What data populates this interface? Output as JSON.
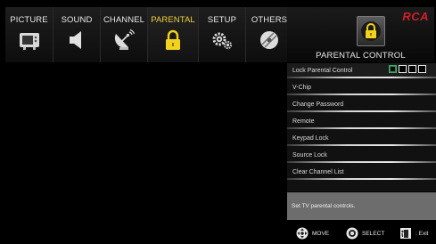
{
  "tabs": [
    {
      "label": "PICTURE",
      "icon": "tv-icon",
      "active": false
    },
    {
      "label": "SOUND",
      "icon": "speaker-icon",
      "active": false
    },
    {
      "label": "CHANNEL",
      "icon": "satellite-dish-icon",
      "active": false
    },
    {
      "label": "PARENTAL",
      "icon": "lock-icon",
      "active": true
    },
    {
      "label": "SETUP",
      "icon": "gears-icon",
      "active": false
    },
    {
      "label": "OTHERS",
      "icon": "disc-icon",
      "active": false
    }
  ],
  "brand": {
    "logo": "RCA",
    "title": "PARENTAL CONTROL",
    "icon": "lock-icon"
  },
  "menu": {
    "items": [
      {
        "label": "Lock Parental Control",
        "pin_boxes": 4
      },
      {
        "label": "V-Chip"
      },
      {
        "label": "Change Password"
      },
      {
        "label": "Remote"
      },
      {
        "label": "Keypad Lock"
      },
      {
        "label": "Source Lock"
      },
      {
        "label": "Clear Channel List"
      }
    ]
  },
  "help_text": "Set TV parental controls.",
  "footer": {
    "move_label": "MOVE",
    "select_label": "SELECT",
    "exit_label": ": Exit"
  },
  "colors": {
    "active_tab_text": "#f0d23a",
    "lock_yellow": "#f2d21c",
    "brand_red": "#d0202a",
    "pin_active": "#3fa86a"
  }
}
